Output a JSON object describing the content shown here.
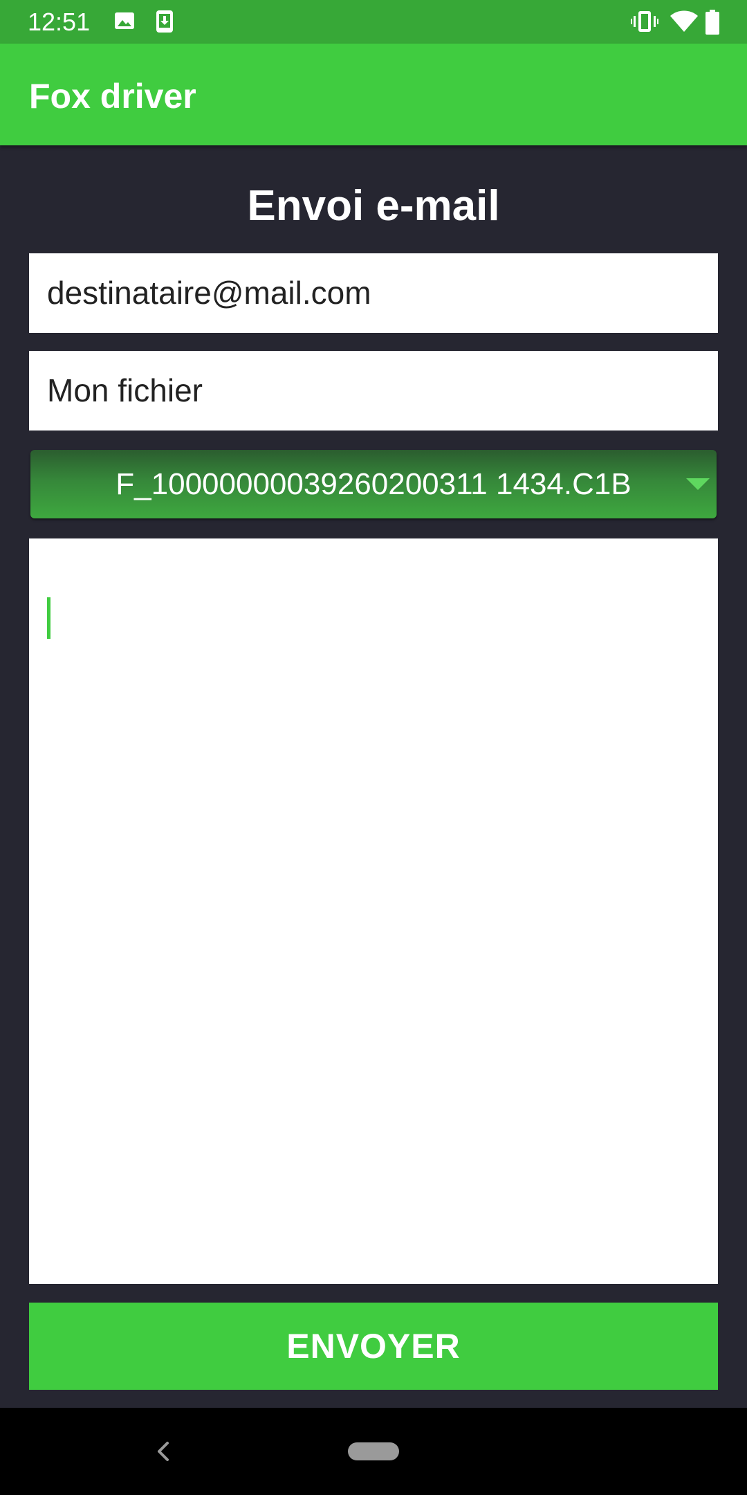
{
  "status_bar": {
    "time": "12:51",
    "left_icons": [
      "image-icon",
      "download-icon"
    ],
    "right_icons": [
      "vibrate-icon",
      "wifi-icon",
      "battery-icon"
    ]
  },
  "app_bar": {
    "title": "Fox driver"
  },
  "form": {
    "heading": "Envoi e-mail",
    "recipient_value": "destinataire@mail.com",
    "subject_value": "Mon fichier",
    "file_selected": "F_10000000039260200311 1434.C1B",
    "message_value": "",
    "send_label": "ENVOYER"
  },
  "nav_bar": {
    "icons": [
      "back-icon",
      "home-pill-icon"
    ]
  },
  "colors": {
    "status_bar": "#37a837",
    "app_bar": "#40cc40",
    "background": "#262631",
    "accent": "#40cc40"
  }
}
